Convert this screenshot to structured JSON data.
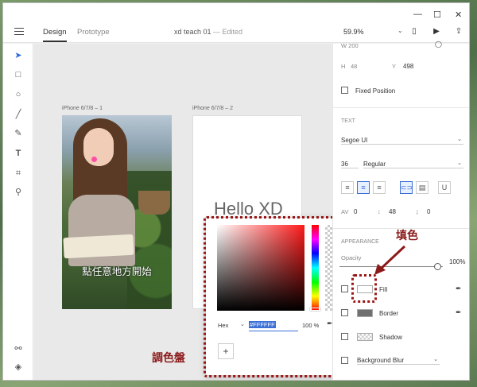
{
  "app": {
    "tabs": [
      "Design",
      "Prototype"
    ],
    "doc_title": "xd teach 01",
    "doc_status": "— Edited",
    "zoom": "59.9%"
  },
  "canvas": {
    "artboard1_label": "iPhone 6/7/8 – 1",
    "artboard2_label": "iPhone 6/7/8 – 2",
    "artboard1_text": "點任意地方開始",
    "artboard2_text": "Hello XD"
  },
  "picker": {
    "mode": "Hex",
    "hex": "#FFFFFF",
    "opacity": "100 %",
    "add": "+"
  },
  "panel": {
    "h_label": "H",
    "h_value": "48",
    "y_label": "Y",
    "y_value": "498",
    "fixed_position": "Fixed Position",
    "text_header": "TEXT",
    "font_family": "Segoe UI",
    "font_size": "36",
    "font_weight": "Regular",
    "char_spacing": "0",
    "line_height": "48",
    "para_spacing": "0",
    "appearance_header": "APPEARANCE",
    "opacity_label": "Opacity",
    "opacity_value": "100%",
    "fill_label": "Fill",
    "fill_color": "#FFFFFF",
    "border_label": "Border",
    "border_color": "#707070",
    "shadow_label": "Shadow",
    "bg_blur_label": "Background Blur"
  },
  "annotations": {
    "palette": "調色盤",
    "fill": "填色",
    "color": "#8b1a1a"
  }
}
